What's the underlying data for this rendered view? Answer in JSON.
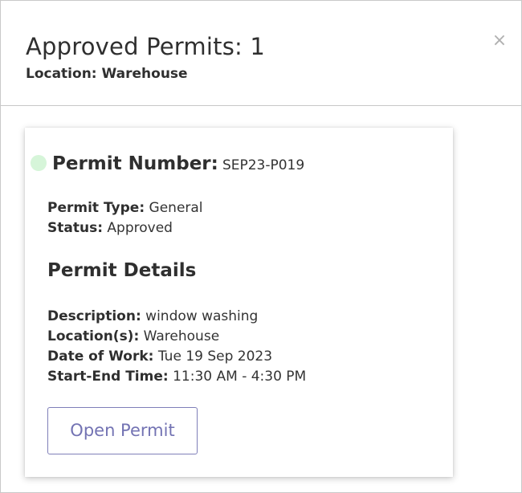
{
  "modal": {
    "title": "Approved Permits: 1",
    "subtitle": "Location: Warehouse",
    "close_label": "×"
  },
  "permit": {
    "number_label": "Permit Number:",
    "number_value": "SEP23-P019",
    "status_dot_color": "#d6f5d9",
    "type_label": "Permit Type:",
    "type_value": "General",
    "status_label": "Status:",
    "status_value": "Approved",
    "details_heading": "Permit Details",
    "description_label": "Description:",
    "description_value": "window washing",
    "locations_label": "Location(s):",
    "locations_value": "Warehouse",
    "date_label": "Date of Work:",
    "date_value": "Tue 19 Sep 2023",
    "time_label": "Start-End Time:",
    "time_value": "11:30 AM - 4:30 PM",
    "open_button_label": "Open Permit"
  },
  "colors": {
    "button_accent": "#7373b3",
    "status_approved": "#d6f5d9"
  }
}
